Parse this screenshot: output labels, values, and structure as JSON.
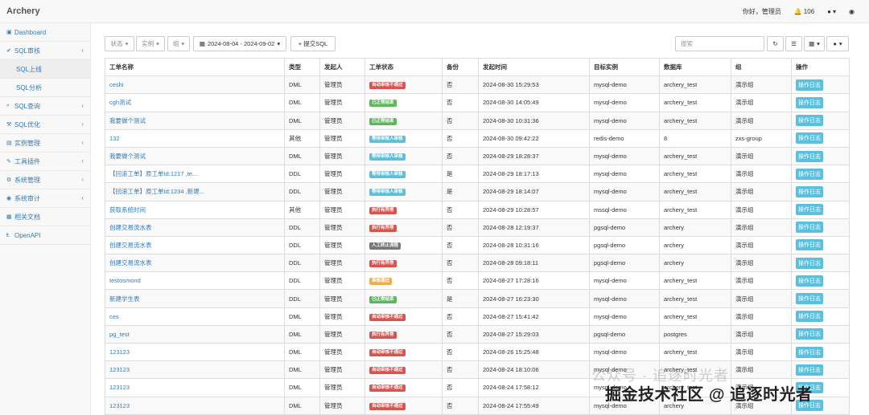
{
  "app": {
    "brand": "Archery"
  },
  "topbar": {
    "greeting": "你好，管理员",
    "notif_count": "106"
  },
  "sidebar": {
    "items": [
      {
        "label": "Dashboard",
        "icon": "dashboard-icon"
      },
      {
        "label": "SQL审核",
        "icon": "check-icon"
      },
      {
        "label": "SQL上线"
      },
      {
        "label": "SQL分析"
      },
      {
        "label": "SQL查询",
        "icon": "search-icon"
      },
      {
        "label": "SQL优化",
        "icon": "wrench-icon"
      },
      {
        "label": "实例管理",
        "icon": "database-icon"
      },
      {
        "label": "工具插件",
        "icon": "plug-icon"
      },
      {
        "label": "系统管理",
        "icon": "gears-icon"
      },
      {
        "label": "系统审计",
        "icon": "eye-icon"
      },
      {
        "label": "相关文档",
        "icon": "book-icon"
      },
      {
        "label": "OpenAPI",
        "icon": "api-icon"
      }
    ]
  },
  "toolbar": {
    "status_label": "状态",
    "instance_label": "实例",
    "group_label": "组",
    "date_range": "2024-08-04 - 2024-09-02",
    "submit_label": "+ 提交SQL",
    "search_placeholder": "搜索"
  },
  "table": {
    "headers": [
      "工单名称",
      "类型",
      "发起人",
      "工单状态",
      "备份",
      "发起时间",
      "目标实例",
      "数据库",
      "组",
      "操作"
    ],
    "rows": [
      {
        "name": "ceshi",
        "type": "DML",
        "user": "管理员",
        "status": "自动审核不通过",
        "status_color": "danger",
        "backup": "否",
        "time": "2024-08-30 15:29:53",
        "instance": "mysql-demo",
        "db": "archery_test",
        "group": "演示组",
        "action": "操作日志"
      },
      {
        "name": "cgh测试",
        "type": "DML",
        "user": "管理员",
        "status": "已正常结束",
        "status_color": "success",
        "backup": "否",
        "time": "2024-08-30 14:05:49",
        "instance": "mysql-demo",
        "db": "archery_test",
        "group": "演示组",
        "action": "操作日志"
      },
      {
        "name": "我要做个测试",
        "type": "DML",
        "user": "管理员",
        "status": "已正常结束",
        "status_color": "success",
        "backup": "否",
        "time": "2024-08-30 10:31:36",
        "instance": "mysql-demo",
        "db": "archery_test",
        "group": "演示组",
        "action": "操作日志"
      },
      {
        "name": "132",
        "type": "其他",
        "user": "管理员",
        "status": "等待审核人审核",
        "status_color": "info",
        "backup": "否",
        "time": "2024-08-30 09:42:22",
        "instance": "redis-demo",
        "db": "8",
        "group": "zxs-group",
        "action": "操作日志"
      },
      {
        "name": "我要做个测试",
        "type": "DML",
        "user": "管理员",
        "status": "等待审核人审核",
        "status_color": "info",
        "backup": "否",
        "time": "2024-08-29 18:28:37",
        "instance": "mysql-demo",
        "db": "archery_test",
        "group": "演示组",
        "action": "操作日志"
      },
      {
        "name": "【回滚工单】原工单Id:1217 ,te...",
        "type": "DDL",
        "user": "管理员",
        "status": "等待审核人审核",
        "status_color": "info",
        "backup": "是",
        "time": "2024-08-29 18:17:13",
        "instance": "mysql-demo",
        "db": "archery_test",
        "group": "演示组",
        "action": "操作日志"
      },
      {
        "name": "【回滚工单】原工单Id:1234 ,新建...",
        "type": "DDL",
        "user": "管理员",
        "status": "等待审核人审核",
        "status_color": "info",
        "backup": "是",
        "time": "2024-08-29 18:14:07",
        "instance": "mysql-demo",
        "db": "archery_test",
        "group": "演示组",
        "action": "操作日志"
      },
      {
        "name": "获取系统时间",
        "type": "其他",
        "user": "管理员",
        "status": "执行有异常",
        "status_color": "danger",
        "backup": "否",
        "time": "2024-08-29 10:28:57",
        "instance": "mssql-demo",
        "db": "archery_test",
        "group": "演示组",
        "action": "操作日志"
      },
      {
        "name": "创建交易流水表",
        "type": "DDL",
        "user": "管理员",
        "status": "执行有异常",
        "status_color": "danger",
        "backup": "否",
        "time": "2024-08-28 12:19:37",
        "instance": "pgsql-demo",
        "db": "archery",
        "group": "演示组",
        "action": "操作日志"
      },
      {
        "name": "创建交易流水表",
        "type": "DDL",
        "user": "管理员",
        "status": "人工终止流程",
        "status_color": "default",
        "backup": "否",
        "time": "2024-08-28 10:31:16",
        "instance": "pgsql-demo",
        "db": "archery",
        "group": "演示组",
        "action": "操作日志"
      },
      {
        "name": "创建交易流水表",
        "type": "DDL",
        "user": "管理员",
        "status": "执行有异常",
        "status_color": "danger",
        "backup": "否",
        "time": "2024-08-28 09:18:11",
        "instance": "pgsql-demo",
        "db": "archery",
        "group": "演示组",
        "action": "操作日志"
      },
      {
        "name": "testosmond",
        "type": "DDL",
        "user": "管理员",
        "status": "审核通过",
        "status_color": "warning",
        "backup": "否",
        "time": "2024-08-27 17:28:16",
        "instance": "mysql-demo",
        "db": "archery_test",
        "group": "演示组",
        "action": "操作日志"
      },
      {
        "name": "新建学生表",
        "type": "DDL",
        "user": "管理员",
        "status": "已正常结束",
        "status_color": "success",
        "backup": "是",
        "time": "2024-08-27 16:23:30",
        "instance": "mysql-demo",
        "db": "archery_test",
        "group": "演示组",
        "action": "操作日志"
      },
      {
        "name": "ces",
        "type": "DML",
        "user": "管理员",
        "status": "自动审核不通过",
        "status_color": "danger",
        "backup": "否",
        "time": "2024-08-27 15:41:42",
        "instance": "mysql-demo",
        "db": "archery_test",
        "group": "演示组",
        "action": "操作日志"
      },
      {
        "name": "pg_test",
        "type": "DML",
        "user": "管理员",
        "status": "执行有异常",
        "status_color": "danger",
        "backup": "否",
        "time": "2024-08-27 15:29:03",
        "instance": "pgsql-demo",
        "db": "postgres",
        "group": "演示组",
        "action": "操作日志"
      },
      {
        "name": "123123",
        "type": "DML",
        "user": "管理员",
        "status": "自动审核不通过",
        "status_color": "danger",
        "backup": "否",
        "time": "2024-08-26 15:25:48",
        "instance": "mysql-demo",
        "db": "archery_test",
        "group": "演示组",
        "action": "操作日志"
      },
      {
        "name": "123123",
        "type": "DML",
        "user": "管理员",
        "status": "自动审核不通过",
        "status_color": "danger",
        "backup": "否",
        "time": "2024-08-24 18:10:06",
        "instance": "mysql-demo",
        "db": "archery_test",
        "group": "演示组",
        "action": "操作日志"
      },
      {
        "name": "123123",
        "type": "DML",
        "user": "管理员",
        "status": "自动审核不通过",
        "status_color": "danger",
        "backup": "否",
        "time": "2024-08-24 17:58:12",
        "instance": "mysql-demo",
        "db": "archery_test",
        "group": "演示组",
        "action": "操作日志"
      },
      {
        "name": "123123",
        "type": "DML",
        "user": "管理员",
        "status": "自动审核不通过",
        "status_color": "danger",
        "backup": "否",
        "time": "2024-08-24 17:55:49",
        "instance": "mysql-demo",
        "db": "archery",
        "group": "演示组",
        "action": "操作日志"
      }
    ]
  },
  "watermark": {
    "faint": "公众号 · 追逐时光者",
    "main": "掘金技术社区 @ 追逐时光者"
  }
}
